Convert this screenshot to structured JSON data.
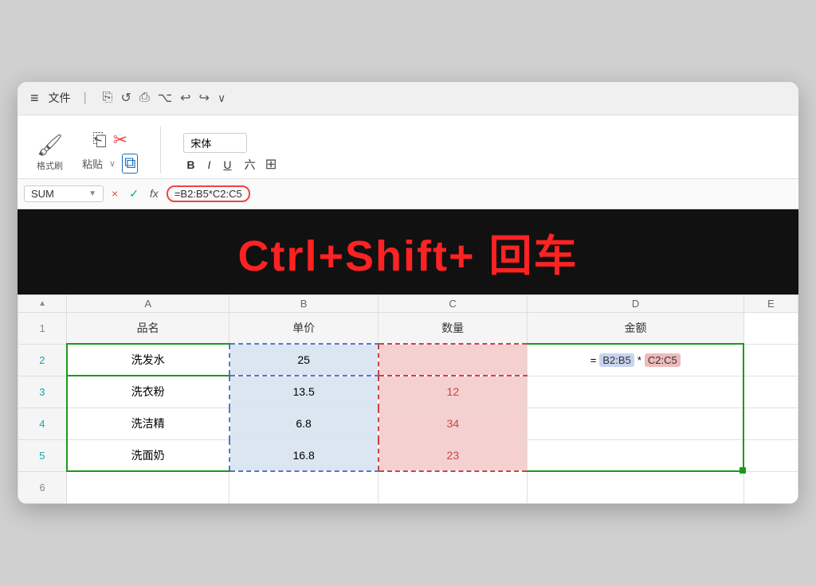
{
  "titlebar": {
    "menu_icon": "≡",
    "file_label": "文件",
    "tools": [
      "⎘",
      "↺",
      "⎙",
      "⛏",
      "↩",
      "↪"
    ],
    "dropdown": "∨"
  },
  "ribbon": {
    "format_brush_label": "格式刷",
    "paste_label": "粘贴",
    "paste_dropdown": "∨",
    "font_name": "宋体",
    "bold": "B",
    "italic": "I",
    "underline": "U",
    "strikethrough": "六",
    "table_icon": "⊞"
  },
  "formula_bar": {
    "cell_ref": "SUM",
    "cancel": "×",
    "confirm": "✓",
    "fx": "fx",
    "formula": "=B2:B5*C2:C5"
  },
  "shortcut": {
    "text": "Ctrl+Shift+ 回车"
  },
  "spreadsheet": {
    "col_headers": [
      "A",
      "B",
      "C",
      "D"
    ],
    "rows": [
      {
        "row_num": "1",
        "cells": [
          "品名",
          "单价",
          "数量",
          "金额"
        ]
      },
      {
        "row_num": "2",
        "cells": [
          "洗发水",
          "25",
          "",
          "= B2:B5 * C2:C5"
        ]
      },
      {
        "row_num": "3",
        "cells": [
          "洗衣粉",
          "13.5",
          "12",
          ""
        ]
      },
      {
        "row_num": "4",
        "cells": [
          "洗洁精",
          "6.8",
          "34",
          ""
        ]
      },
      {
        "row_num": "5",
        "cells": [
          "洗面奶",
          "16.8",
          "23",
          ""
        ]
      },
      {
        "row_num": "6",
        "cells": [
          "",
          "",
          "",
          ""
        ]
      }
    ]
  }
}
